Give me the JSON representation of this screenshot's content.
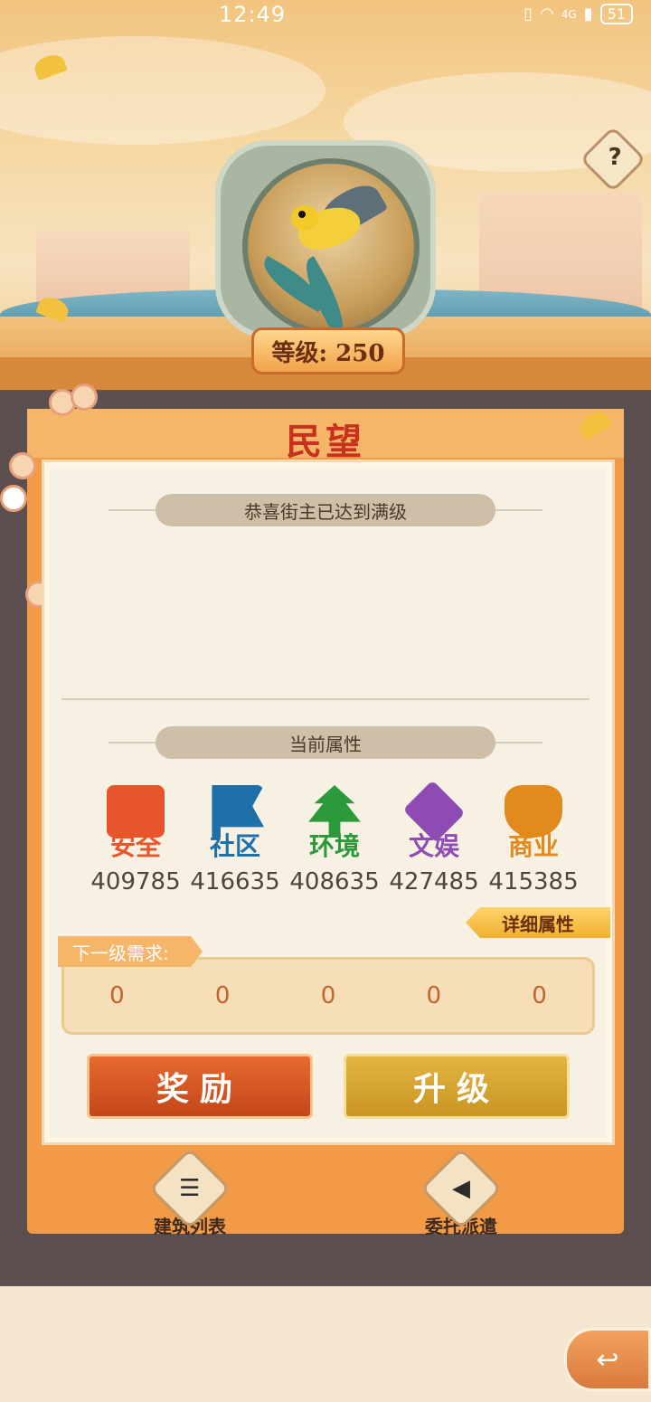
{
  "status_bar": {
    "time": "12:49",
    "signal_text": "4G",
    "battery": "51"
  },
  "header": {
    "level_label": "等级: 250"
  },
  "panel": {
    "title": "民望",
    "max_level_message": "恭喜街主已达到满级",
    "current_attributes_title": "当前属性",
    "attributes": [
      {
        "label": "安全",
        "value": "409785",
        "color": "#e8552b",
        "icon": "gate-icon"
      },
      {
        "label": "社区",
        "value": "416635",
        "color": "#1f6fa8",
        "icon": "flag-icon"
      },
      {
        "label": "环境",
        "value": "408635",
        "color": "#2c9a3a",
        "icon": "tree-icon"
      },
      {
        "label": "文娱",
        "value": "427485",
        "color": "#8f4bb4",
        "icon": "dice-icon"
      },
      {
        "label": "商业",
        "value": "415385",
        "color": "#e28a1d",
        "icon": "crown-icon"
      }
    ],
    "detail_attributes_label": "详细属性",
    "next_level_label": "下一级需求:",
    "next_level_requirements": [
      "0",
      "0",
      "0",
      "0",
      "0"
    ],
    "reward_button": "奖励",
    "upgrade_button": "升级"
  },
  "bottom_nav": {
    "building_list": "建筑列表",
    "dispatch": "委托派遣"
  }
}
